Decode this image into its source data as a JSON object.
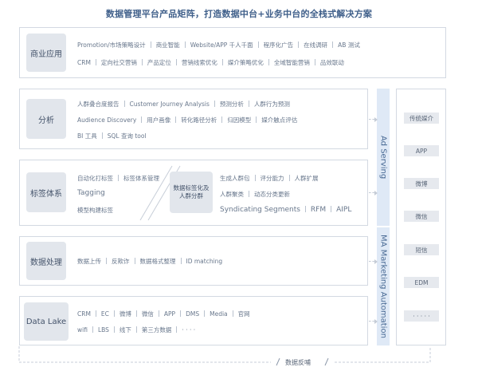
{
  "title": "数据管理平台产品矩阵，打造数据中台+业务中台的全栈式解决方案",
  "sections": {
    "business": {
      "label": "商业应用",
      "row1": [
        "Promotion/市场策略设计",
        "商业智能",
        "Website/APP 千人千面",
        "程序化广告",
        "在线调研",
        "AB 测试"
      ],
      "row2": [
        "CRM",
        "定向社交营销",
        "产品定位",
        "营销线索优化",
        "媒介策略优化",
        "全域智能营销",
        "品效联动"
      ]
    },
    "analysis": {
      "label": "分析",
      "row1": [
        "人群叠合度报告",
        "Customer Journey Analysis",
        "预测分析",
        "人群行为预测"
      ],
      "row2": [
        "Audience Discovery",
        "用户画像",
        "转化路径分析",
        "归因模型",
        "媒介触点评估"
      ],
      "row3": [
        "BI 工具",
        "SQL 查询 tool"
      ]
    },
    "tagging": {
      "label": "标签体系",
      "left_row1": [
        "自动化打标签",
        "标签体系管理"
      ],
      "left_row2": "Tagging",
      "left_row3": "模型构建标签",
      "mid_label": "数据标签化及人群分群",
      "right_row1": [
        "生成人群包",
        "评分能力",
        "人群扩展"
      ],
      "right_row2": [
        "人群聚类",
        "动态分类更新"
      ],
      "right_row3": [
        "Syndicating Segments",
        "RFM",
        "AIPL"
      ]
    },
    "processing": {
      "label": "数据处理",
      "row1": [
        "数据上传",
        "反欺诈",
        "数据格式整理",
        "ID matching"
      ]
    },
    "datalake": {
      "label": "Data Lake",
      "row1": [
        "CRM",
        "EC",
        "微博",
        "微信",
        "APP",
        "DMS",
        "Media",
        "官网"
      ],
      "row2": [
        "wifi",
        "LBS",
        "线下",
        "第三方数据",
        "· · · ·"
      ]
    }
  },
  "side_bands": {
    "ad_serving": "Ad Serving",
    "ma": "MA Marketing Automation"
  },
  "channels": [
    "传统媒介",
    "APP",
    "微博",
    "微信",
    "短信",
    "EDM",
    "· · · · ·"
  ],
  "feedback": "数据反哺"
}
